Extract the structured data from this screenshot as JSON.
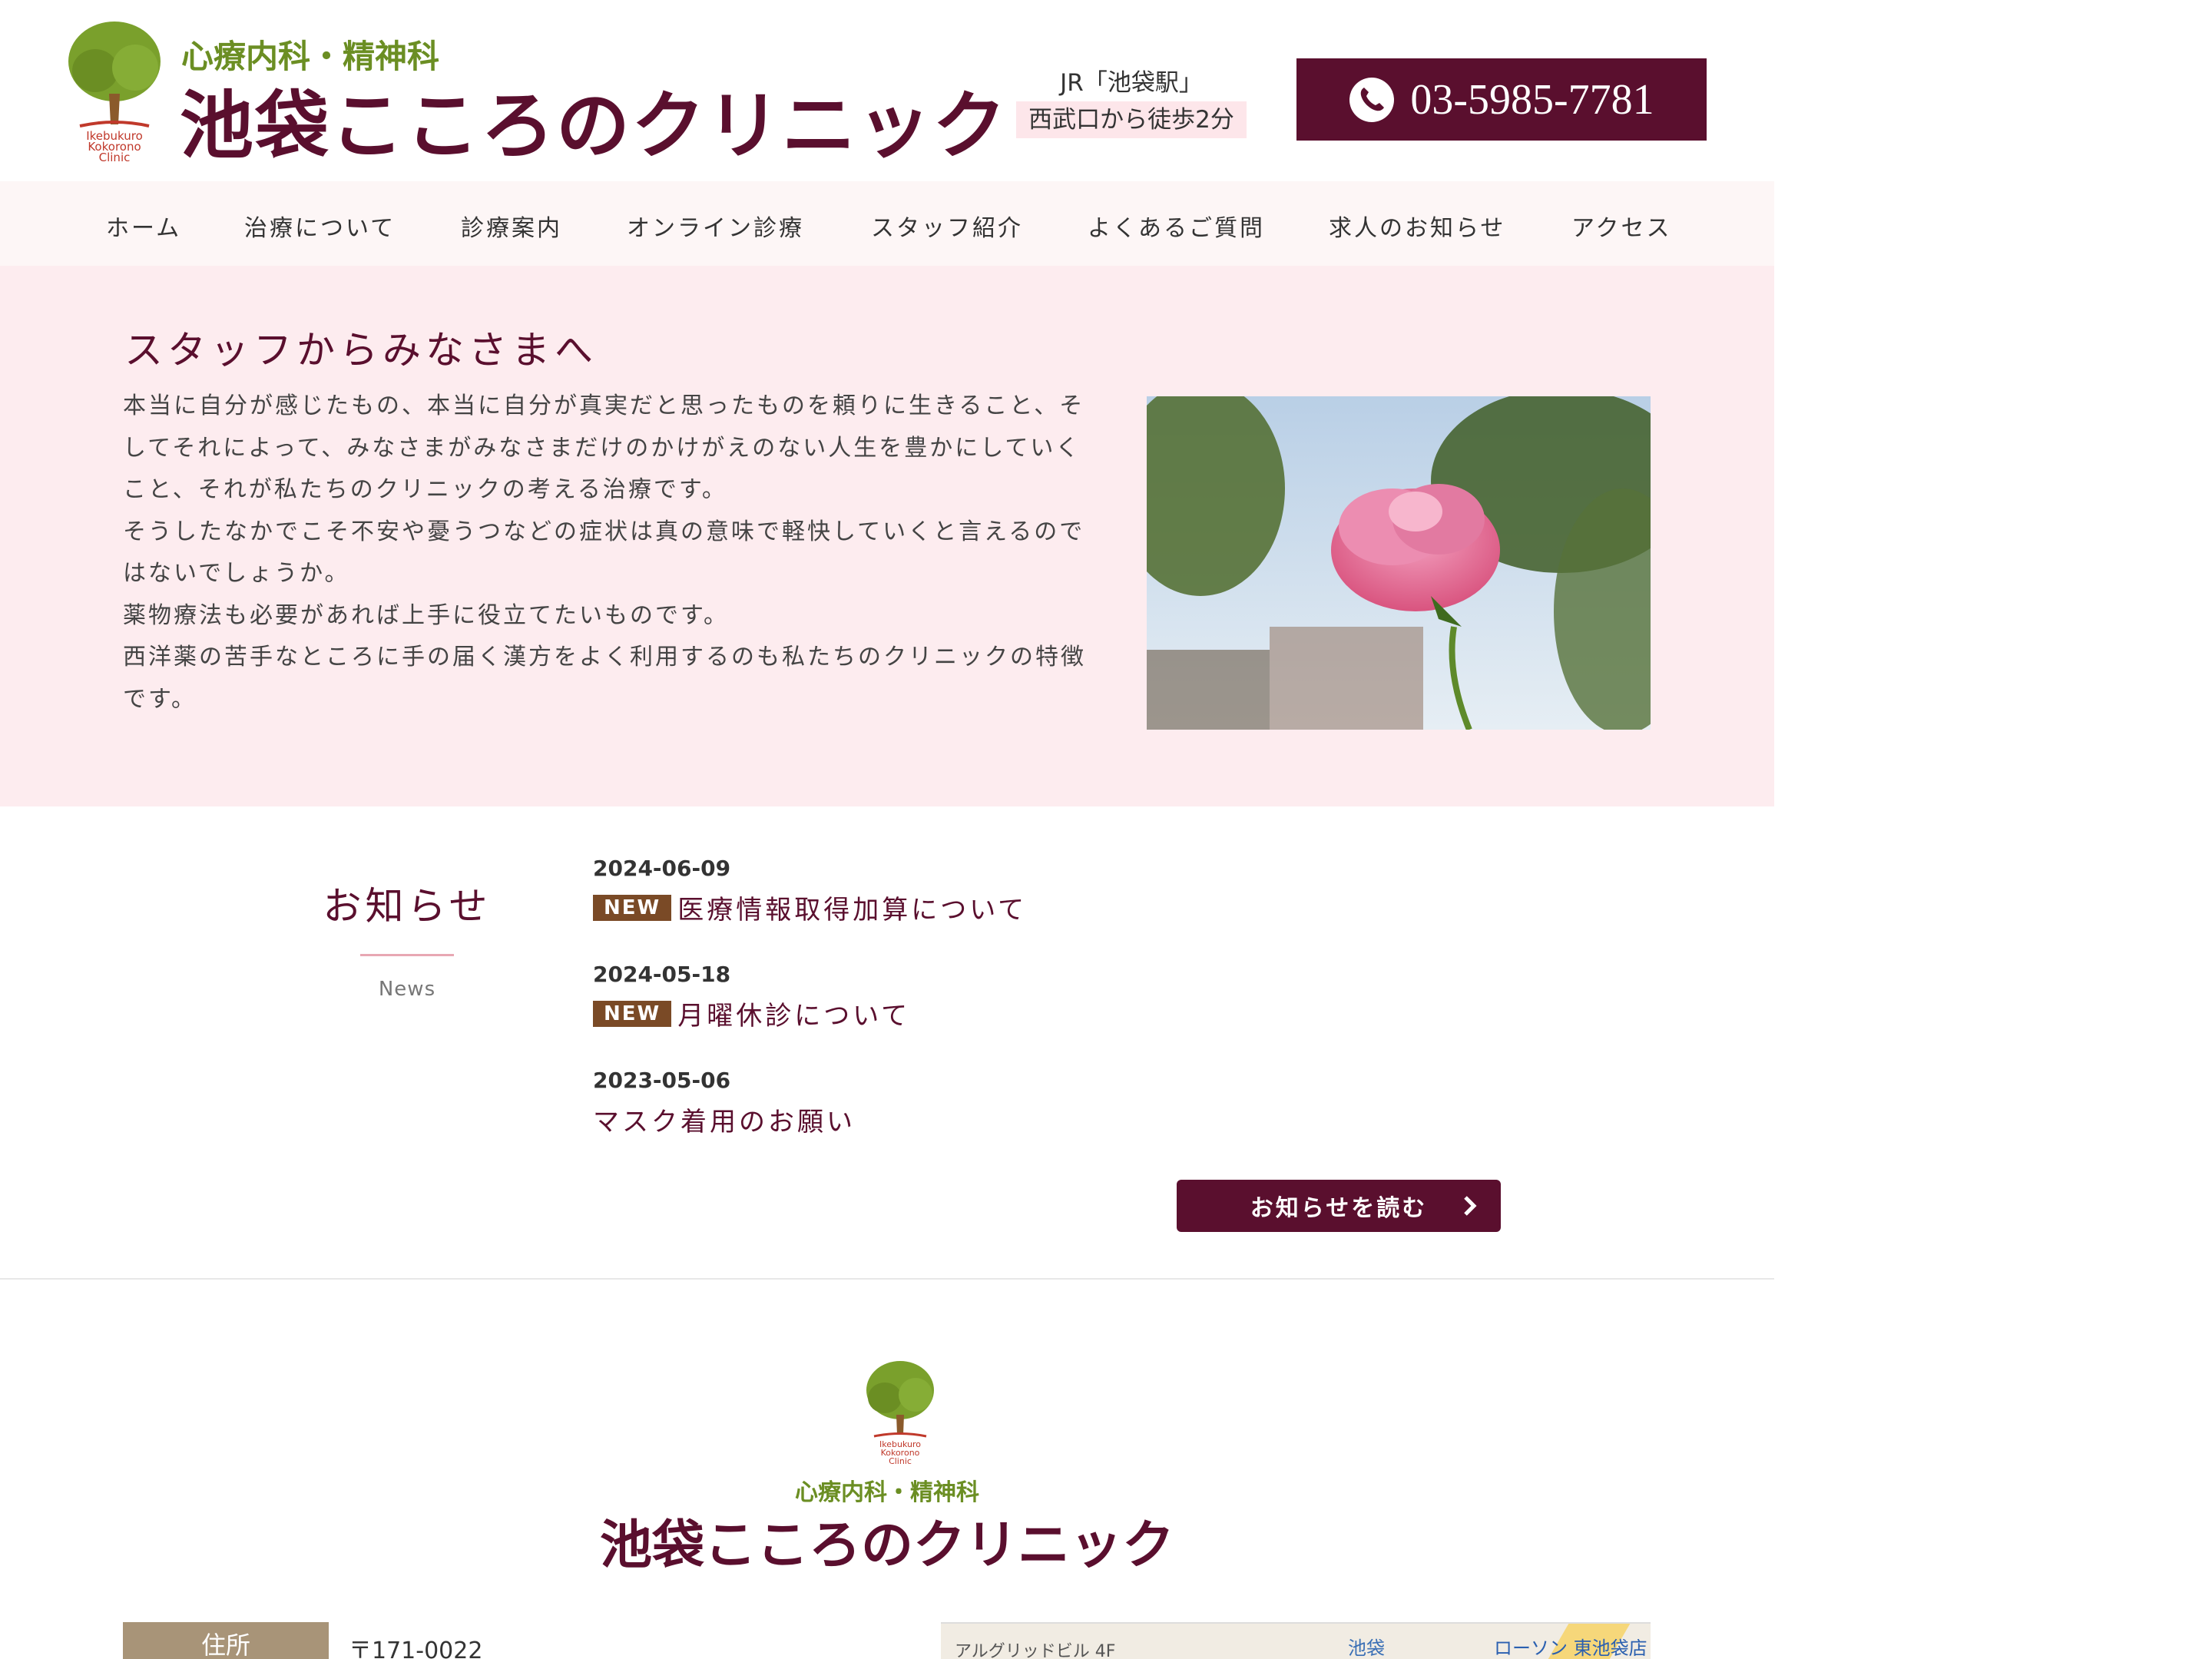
{
  "header": {
    "logo_small": "心療内科・精神科",
    "logo_big": "池袋こころのクリニック",
    "logo_tree_text": [
      "Ikebukuro",
      "Kokorono",
      "Clinic"
    ],
    "station_line1": "JR「池袋駅」",
    "station_line2": "西武口から徒歩2分",
    "phone": "03-5985-7781"
  },
  "nav": {
    "items": [
      "ホーム",
      "治療について",
      "診療案内",
      "オンライン診療",
      "スタッフ紹介",
      "よくあるご質問",
      "求人のお知らせ",
      "アクセス"
    ]
  },
  "hero": {
    "title": "スタッフからみなさまへ",
    "paragraphs": [
      "本当に自分が感じたもの、本当に自分が真実だと思ったものを頼りに生きること、そしてそれによって、みなさまがみなさまだけのかけがえのない人生を豊かにしていくこと、それが私たちのクリニックの考える治療です。",
      "そうしたなかでこそ不安や憂うつなどの症状は真の意味で軽快していくと言えるのではないでしょうか。",
      "薬物療法も必要があれば上手に役立てたいものです。",
      "西洋薬の苦手なところに手の届く漢方をよく利用するのも私たちのクリニックの特徴です。"
    ]
  },
  "news": {
    "title": "お知らせ",
    "subtitle": "News",
    "items": [
      {
        "date": "2024-06-09",
        "badge": "NEW",
        "title": "医療情報取得加算について"
      },
      {
        "date": "2024-05-18",
        "badge": "NEW",
        "title": "月曜休診について"
      },
      {
        "date": "2023-05-06",
        "badge": "",
        "title": "マスク着用のお願い"
      }
    ],
    "read_more": "お知らせを読む"
  },
  "footer": {
    "logo_small": "心療内科・精神科",
    "logo_big": "池袋こころのクリニック",
    "address_label": "住所",
    "address_value": "〒171-0022",
    "map_labels": [
      "アルグリッドビル 4F",
      "池袋",
      "ローソン 東池袋店"
    ]
  },
  "colors": {
    "brand": "#5a0f2e",
    "leaf": "#6b8e23",
    "hero_bg": "#fdecef",
    "badge": "#7a4a26",
    "label_bg": "#a89478"
  }
}
